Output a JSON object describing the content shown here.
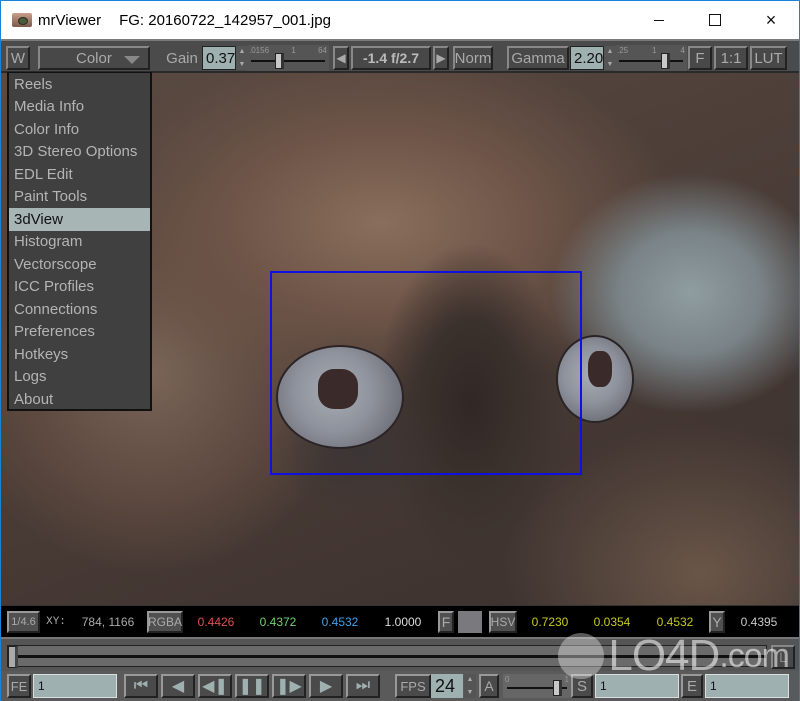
{
  "window": {
    "app_name": "mrViewer",
    "file_title": "FG: 20160722_142957_001.jpg",
    "controls": {
      "minimize": "minimize-icon",
      "maximize": "maximize-icon",
      "close": "×"
    }
  },
  "toolbar": {
    "window_button": "W",
    "channel_select": "Color",
    "gain_label": "Gain",
    "gain_value": "0.37",
    "gain_slider_ticks": [
      ".0156",
      "1",
      "64"
    ],
    "exposure_prev": "◀",
    "exposure_text": "-1.4  f/2.7",
    "exposure_next": "▶",
    "norm_button": "Norm",
    "gamma_button": "Gamma",
    "gamma_value": "2.20",
    "gamma_slider_ticks": [
      ".25",
      "1",
      "4"
    ],
    "field_button": "F",
    "ratio_button": "1:1",
    "lut_button": "LUT"
  },
  "menu": {
    "items": [
      {
        "label": "Reels",
        "selected": false
      },
      {
        "label": "Media Info",
        "selected": false
      },
      {
        "label": "Color Info",
        "selected": false
      },
      {
        "label": "3D Stereo Options",
        "selected": false
      },
      {
        "label": "EDL Edit",
        "selected": false
      },
      {
        "label": "Paint Tools",
        "selected": false
      },
      {
        "label": "3dView",
        "selected": true
      },
      {
        "label": "Histogram",
        "selected": false
      },
      {
        "label": "Vectorscope",
        "selected": false
      },
      {
        "label": "ICC Profiles",
        "selected": false
      },
      {
        "label": "Connections",
        "selected": false
      },
      {
        "label": "Preferences",
        "selected": false
      },
      {
        "label": "Hotkeys",
        "selected": false
      },
      {
        "label": "Logs",
        "selected": false
      },
      {
        "label": "About",
        "selected": false
      }
    ]
  },
  "status": {
    "zoom_button": "1/4.6",
    "xy_label": "XY:",
    "xy_value": "784, 1166",
    "rgba_button": "RGBA",
    "r": "0.4426",
    "g": "0.4372",
    "b": "0.4532",
    "a": "1.0000",
    "f_button": "F",
    "hsv_button": "HSV",
    "h": "0.7230",
    "s": "0.0354",
    "v": "0.4532",
    "y_button": "Y",
    "y_value": "0.4395",
    "colors": {
      "r": "#e05050",
      "g": "#70d070",
      "b": "#40a0e8",
      "a": "#dddddd",
      "hsv": "#c8c820",
      "y": "#c8c8c8",
      "swatch": "#7a7a7e"
    }
  },
  "timeline": {
    "end_button": "L"
  },
  "controls": {
    "frame_mode_button": "FE",
    "frame_value": "1",
    "transport": [
      {
        "name": "go-to-start-button",
        "glyph": "⏮"
      },
      {
        "name": "step-back-button",
        "glyph": "◀"
      },
      {
        "name": "play-backward-button",
        "glyph": "◀❚"
      },
      {
        "name": "pause-button",
        "glyph": "❚❚"
      },
      {
        "name": "play-forward-button",
        "glyph": "❚▶"
      },
      {
        "name": "step-forward-button",
        "glyph": "▶"
      },
      {
        "name": "go-to-end-button",
        "glyph": "⏭"
      }
    ],
    "fps_button": "FPS",
    "fps_value": "24",
    "audio_button": "A",
    "volume_ticks": [
      "0",
      "1"
    ],
    "start_button": "S",
    "start_value": "1",
    "end_button": "E",
    "end_value": "1"
  },
  "watermark": {
    "text": "LO4D",
    "suffix": ".com"
  }
}
